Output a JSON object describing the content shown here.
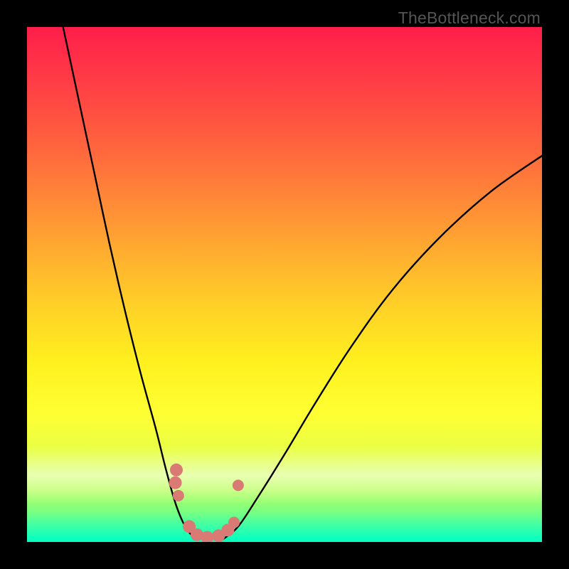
{
  "attribution": "TheBottleneck.com",
  "chart_data": {
    "type": "line",
    "title": "",
    "xlabel": "",
    "ylabel": "",
    "xlim": [
      0,
      100
    ],
    "ylim": [
      0,
      100
    ],
    "legend": false,
    "background_gradient": {
      "orientation": "vertical",
      "stops": [
        {
          "pos": 0.0,
          "color": "#ff1e4a",
          "meaning": "severe bottleneck"
        },
        {
          "pos": 0.5,
          "color": "#ffd327",
          "meaning": "moderate"
        },
        {
          "pos": 0.85,
          "color": "#e3ff4a",
          "meaning": "low"
        },
        {
          "pos": 1.0,
          "color": "#00ffc2",
          "meaning": "optimal / no bottleneck"
        }
      ]
    },
    "series": [
      {
        "name": "left-curve",
        "description": "Descending bottleneck curve from top-left down to minimum",
        "points": [
          {
            "x": 7,
            "y": 100
          },
          {
            "x": 10,
            "y": 86
          },
          {
            "x": 13,
            "y": 72
          },
          {
            "x": 16,
            "y": 58
          },
          {
            "x": 19,
            "y": 45
          },
          {
            "x": 22,
            "y": 33
          },
          {
            "x": 25,
            "y": 22
          },
          {
            "x": 27,
            "y": 14
          },
          {
            "x": 29,
            "y": 7
          },
          {
            "x": 31,
            "y": 2.5
          },
          {
            "x": 33,
            "y": 0.5
          }
        ]
      },
      {
        "name": "right-curve",
        "description": "Ascending bottleneck curve from minimum up toward top-right",
        "points": [
          {
            "x": 38,
            "y": 0.5
          },
          {
            "x": 41,
            "y": 3
          },
          {
            "x": 45,
            "y": 9
          },
          {
            "x": 50,
            "y": 17
          },
          {
            "x": 56,
            "y": 27
          },
          {
            "x": 63,
            "y": 38
          },
          {
            "x": 71,
            "y": 49
          },
          {
            "x": 80,
            "y": 59
          },
          {
            "x": 90,
            "y": 68
          },
          {
            "x": 100,
            "y": 75
          }
        ]
      }
    ],
    "markers": {
      "name": "sample-points",
      "color": "#d97a74",
      "description": "Highlighted data points near the minimum of the V",
      "points": [
        {
          "x": 29.0,
          "y": 14.0,
          "r": 9
        },
        {
          "x": 28.8,
          "y": 11.5,
          "r": 9
        },
        {
          "x": 29.4,
          "y": 9.0,
          "r": 8
        },
        {
          "x": 31.5,
          "y": 3.0,
          "r": 9
        },
        {
          "x": 33.0,
          "y": 1.4,
          "r": 9
        },
        {
          "x": 35.0,
          "y": 0.9,
          "r": 9
        },
        {
          "x": 37.2,
          "y": 1.2,
          "r": 9
        },
        {
          "x": 39.0,
          "y": 2.3,
          "r": 9
        },
        {
          "x": 40.2,
          "y": 3.8,
          "r": 8
        },
        {
          "x": 41.0,
          "y": 11.0,
          "r": 8
        }
      ]
    }
  }
}
